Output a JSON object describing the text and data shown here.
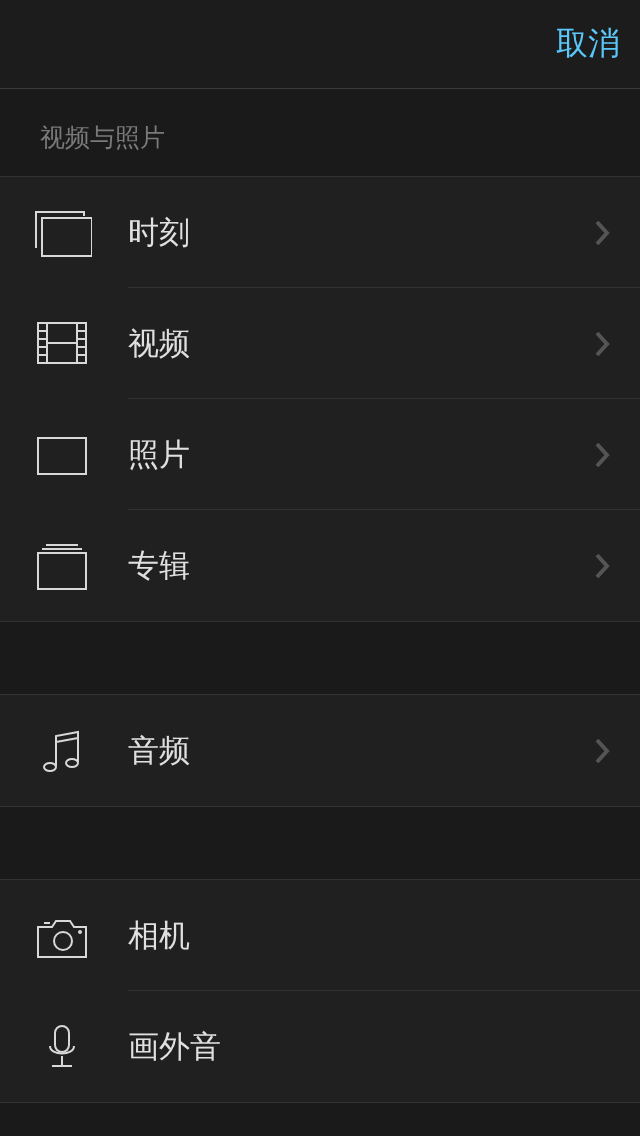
{
  "top_bar": {
    "cancel_button": "取消"
  },
  "section_title": "视频与照片",
  "groups": [
    {
      "items": [
        {
          "label": "时刻",
          "kind": "moments",
          "disclosure": true
        },
        {
          "label": "视频",
          "kind": "film",
          "disclosure": true
        },
        {
          "label": "照片",
          "kind": "photo",
          "disclosure": true
        },
        {
          "label": "专辑",
          "kind": "album",
          "disclosure": true
        }
      ]
    },
    {
      "items": [
        {
          "label": "音频",
          "kind": "music",
          "disclosure": true
        }
      ]
    },
    {
      "items": [
        {
          "label": "相机",
          "kind": "camera",
          "disclosure": false
        },
        {
          "label": "画外音",
          "kind": "mic",
          "disclosure": false
        }
      ]
    }
  ]
}
